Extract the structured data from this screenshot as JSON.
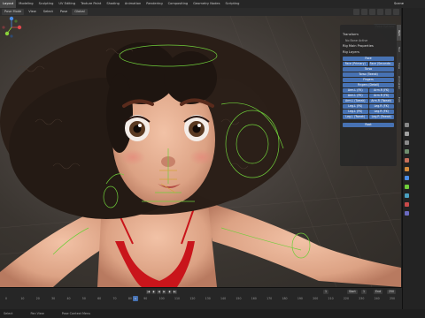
{
  "topbar": {
    "tabs": [
      {
        "label": "Layout",
        "active": true
      },
      {
        "label": "Modeling",
        "active": false
      },
      {
        "label": "Sculpting",
        "active": false
      },
      {
        "label": "UV Editing",
        "active": false
      },
      {
        "label": "Texture Paint",
        "active": false
      },
      {
        "label": "Shading",
        "active": false
      },
      {
        "label": "Animation",
        "active": false
      },
      {
        "label": "Rendering",
        "active": false
      },
      {
        "label": "Compositing",
        "active": false
      },
      {
        "label": "Geometry Nodes",
        "active": false
      },
      {
        "label": "Scripting",
        "active": false
      }
    ],
    "scene_label": "Scene"
  },
  "viewport_header": {
    "mode": "Pose Mode",
    "view": "View",
    "select": "Select",
    "pose": "Pose",
    "transform": "Global"
  },
  "npanel": {
    "pose_options": "Pose Options",
    "transform_header": "Transform",
    "no_bone": "No Bone Active",
    "rig_main_header": "Rig Main Properties",
    "rig_layers_header": "Rig Layers",
    "buttons": [
      [
        "Face"
      ],
      [
        "Face (Primary)",
        "Face (Seconda..."
      ],
      [
        "Torso"
      ],
      [
        "Torso (Tweak)"
      ],
      [
        "Fingers"
      ],
      [
        "Fingers (Detail)"
      ],
      [
        "Arm.L (FK)",
        "Arm.R (FK)"
      ],
      [
        "Arm.L (FK)",
        "Arm.R (FK)"
      ],
      [
        "Arm.L (Tweak)",
        "Arm.R (Tweak)"
      ],
      [
        "Leg.L (FK)",
        "Leg.R (FK)"
      ],
      [
        "Leg.L (FK)",
        "Leg.R (FK)"
      ],
      [
        "Leg.L (Tweak)",
        "Leg.R (Tweak)"
      ]
    ],
    "root_label": "Root",
    "vtabs": [
      "Item",
      "Tool",
      "View",
      "Animation",
      "Edit"
    ]
  },
  "timeline": {
    "current_frame": "1",
    "start_label": "Start",
    "start_value": "1",
    "end_label": "End",
    "end_value": "250",
    "ruler": [
      "0",
      "10",
      "20",
      "30",
      "40",
      "50",
      "60",
      "70",
      "80",
      "90",
      "100",
      "110",
      "120",
      "130",
      "140",
      "150",
      "160",
      "170",
      "180",
      "190",
      "200",
      "210",
      "220",
      "230",
      "240",
      "250"
    ]
  },
  "statusbar": {
    "left": "Select",
    "mid": "Pan View",
    "right": "Pose Context Menu"
  },
  "colors": {
    "accent": "#4772b3",
    "bone_green": "#6fce3a",
    "gizmo_x": "#e0474c",
    "gizmo_y": "#8bd33a",
    "gizmo_z": "#4a8de6"
  }
}
